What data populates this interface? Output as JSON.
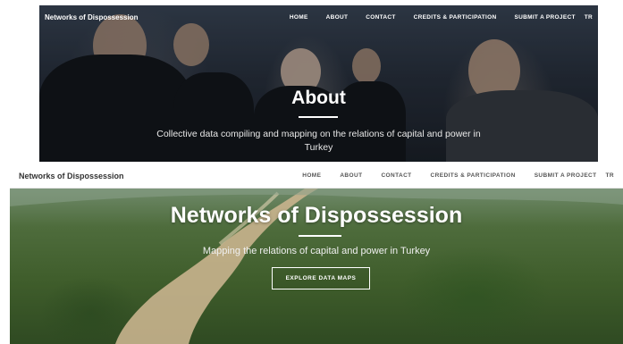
{
  "about_page": {
    "nav": {
      "brand": "Networks of Dispossession",
      "items": [
        "HOME",
        "ABOUT",
        "CONTACT",
        "CREDITS & PARTICIPATION",
        "SUBMIT A PROJECT",
        "TR"
      ]
    },
    "hero": {
      "title": "About",
      "subtitle": "Collective data compiling and mapping on the relations of capital and power in Turkey"
    }
  },
  "home_page": {
    "nav": {
      "brand": "Networks of Dispossession",
      "items": [
        "HOME",
        "ABOUT",
        "CONTACT",
        "CREDITS & PARTICIPATION",
        "SUBMIT A PROJECT",
        "TR"
      ]
    },
    "hero": {
      "title": "Networks of Dispossession",
      "subtitle": "Mapping the relations of capital and power in Turkey",
      "cta_label": "EXPLORE DATA MAPS"
    }
  },
  "colors": {
    "nav_text_dark_bg": "#ffffff",
    "nav_text_light_bg": "#555555",
    "brand_light": "#333333",
    "hero_text": "#ffffff"
  }
}
